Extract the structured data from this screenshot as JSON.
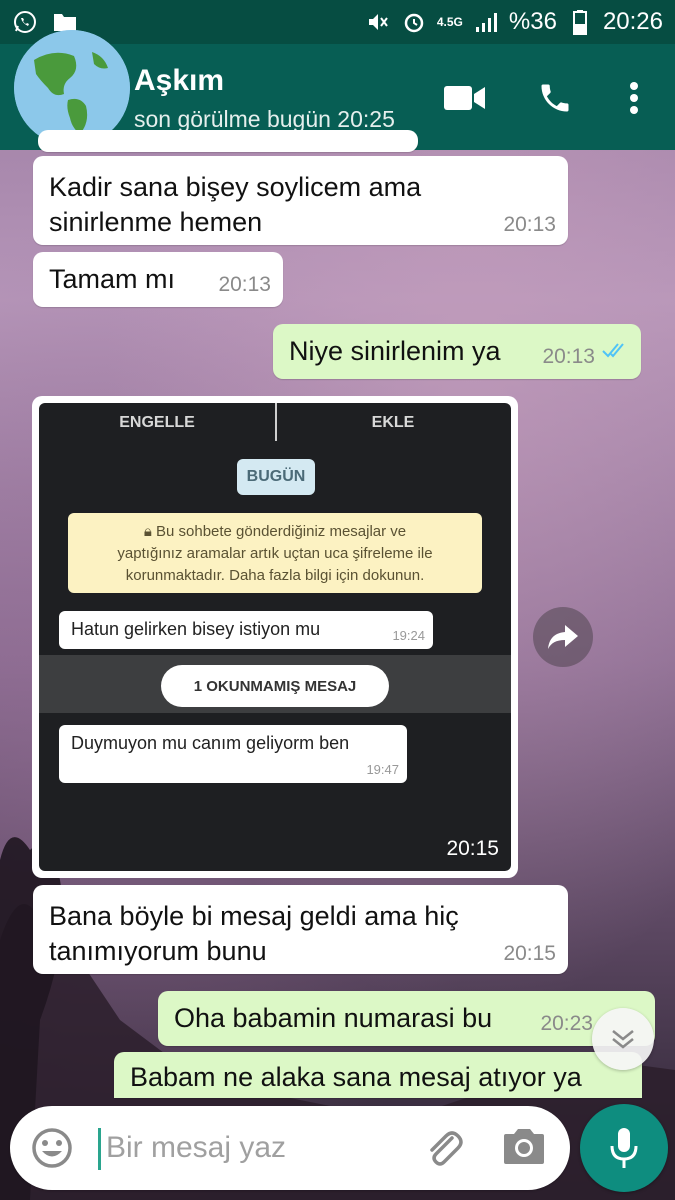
{
  "status_bar": {
    "network": "4.5G",
    "battery": "%36",
    "time": "20:26"
  },
  "header": {
    "contact_name": "Aşkım",
    "last_seen": "son görülme bugün 20:25"
  },
  "messages": [
    {
      "id": "m1",
      "direction": "in",
      "text_line1": "Kadir sana bişey soylicem ama",
      "text_line2": "sinirlenme hemen",
      "time": "20:13"
    },
    {
      "id": "m2",
      "direction": "in",
      "text": "Tamam mı",
      "time": "20:13"
    },
    {
      "id": "m3",
      "direction": "out",
      "text": "Niye sinirlenim ya",
      "time": "20:13",
      "status": "read"
    },
    {
      "id": "m4",
      "direction": "in",
      "type": "image",
      "time": "20:15"
    },
    {
      "id": "m5",
      "direction": "in",
      "text_line1": "Bana böyle bi mesaj geldi ama hiç",
      "text_line2": "tanımıyorum bunu",
      "time": "20:15"
    },
    {
      "id": "m6",
      "direction": "out",
      "text": "Oha babamin numarasi bu",
      "time": "20:23",
      "status": "read"
    },
    {
      "id": "m7",
      "direction": "out",
      "text": "Babam ne alaka sana mesaj atıyor ya"
    }
  ],
  "embedded_screenshot": {
    "block_label": "ENGELLE",
    "add_label": "EKLE",
    "date_chip": "BUGÜN",
    "notice_line1": "Bu sohbete gönderdiğiniz mesajlar ve",
    "notice_line2": "yaptığınız aramalar artık uçtan uca şifreleme ile",
    "notice_line3": "korunmaktadır. Daha fazla bilgi için dokunun.",
    "msg1_text": "Hatun gelirken bisey istiyon mu",
    "msg1_time": "19:24",
    "unread_label": "1 OKUNMAMIŞ MESAJ",
    "msg2_text": "Duymuyon mu canım geliyorm ben",
    "msg2_time": "19:47"
  },
  "input": {
    "placeholder": "Bir mesaj yaz"
  },
  "colors": {
    "header": "#075e54",
    "status_bar": "#064d42",
    "outgoing_bubble": "#dcf8c6",
    "incoming_bubble": "#ffffff",
    "mic_button": "#0e8d7f",
    "read_ticks": "#4fc3f7"
  },
  "icons": [
    "whatsapp-icon",
    "folder-icon",
    "mute-icon",
    "alarm-icon",
    "signal-icon",
    "battery-icon",
    "video-call-icon",
    "phone-icon",
    "more-icon",
    "forward-icon",
    "scroll-down-icon",
    "emoji-icon",
    "attach-icon",
    "camera-icon",
    "mic-icon"
  ]
}
